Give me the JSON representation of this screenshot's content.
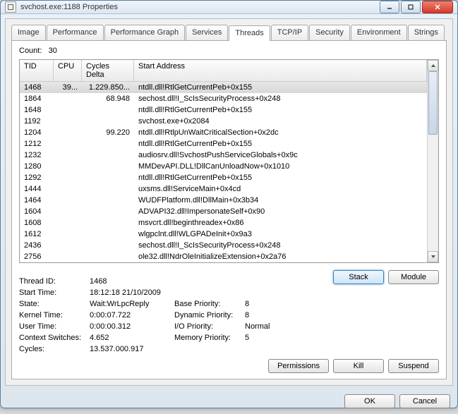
{
  "window": {
    "title": "svchost.exe:1188 Properties"
  },
  "tabs": [
    "Image",
    "Performance",
    "Performance Graph",
    "Services",
    "Threads",
    "TCP/IP",
    "Security",
    "Environment",
    "Strings"
  ],
  "active_tab": 4,
  "count_label": "Count:",
  "count_value": "30",
  "columns": {
    "tid": "TID",
    "cpu": "CPU",
    "cyc": "Cycles Delta",
    "addr": "Start Address"
  },
  "rows": [
    {
      "tid": "1468",
      "cpu": "39...",
      "cyc": "1.229.850...",
      "addr": "ntdll.dll!RtlGetCurrentPeb+0x155",
      "sel": true
    },
    {
      "tid": "1864",
      "cpu": "",
      "cyc": "68.948",
      "addr": "sechost.dll!I_ScIsSecurityProcess+0x248"
    },
    {
      "tid": "1648",
      "cpu": "",
      "cyc": "",
      "addr": "ntdll.dll!RtlGetCurrentPeb+0x155"
    },
    {
      "tid": "1192",
      "cpu": "",
      "cyc": "",
      "addr": "svchost.exe+0x2084"
    },
    {
      "tid": "1204",
      "cpu": "",
      "cyc": "99.220",
      "addr": "ntdll.dll!RtlpUnWaitCriticalSection+0x2dc"
    },
    {
      "tid": "1212",
      "cpu": "",
      "cyc": "",
      "addr": "ntdll.dll!RtlGetCurrentPeb+0x155"
    },
    {
      "tid": "1232",
      "cpu": "",
      "cyc": "",
      "addr": "audiosrv.dll!SvchostPushServiceGlobals+0x9c"
    },
    {
      "tid": "1280",
      "cpu": "",
      "cyc": "",
      "addr": "MMDevAPI.DLL!DllCanUnloadNow+0x1010"
    },
    {
      "tid": "1292",
      "cpu": "",
      "cyc": "",
      "addr": "ntdll.dll!RtlGetCurrentPeb+0x155"
    },
    {
      "tid": "1444",
      "cpu": "",
      "cyc": "",
      "addr": "uxsms.dll!ServiceMain+0x4cd"
    },
    {
      "tid": "1464",
      "cpu": "",
      "cyc": "",
      "addr": "WUDFPlatform.dll!DllMain+0x3b34"
    },
    {
      "tid": "1604",
      "cpu": "",
      "cyc": "",
      "addr": "ADVAPI32.dll!ImpersonateSelf+0x90"
    },
    {
      "tid": "1608",
      "cpu": "",
      "cyc": "",
      "addr": "msvcrt.dll!beginthreadex+0x86"
    },
    {
      "tid": "1612",
      "cpu": "",
      "cyc": "",
      "addr": "wlgpclnt.dll!WLGPADeInit+0x9a3"
    },
    {
      "tid": "2436",
      "cpu": "",
      "cyc": "",
      "addr": "sechost.dll!I_ScIsSecurityProcess+0x248"
    },
    {
      "tid": "2756",
      "cpu": "",
      "cyc": "",
      "addr": "ole32.dll!NdrOleInitializeExtension+0x2a76"
    }
  ],
  "details": {
    "thread_id_label": "Thread ID:",
    "thread_id": "1468",
    "start_time_label": "Start Time:",
    "start_time": "18:12:18   21/10/2009",
    "state_label": "State:",
    "state": "Wait:WrLpcReply",
    "kernel_time_label": "Kernel Time:",
    "kernel_time": "0:00:07.722",
    "user_time_label": "User Time:",
    "user_time": "0:00:00.312",
    "ctx_label": "Context Switches:",
    "ctx": "4.652",
    "cycles_label": "Cycles:",
    "cycles": "13.537.000.917",
    "base_prio_label": "Base Priority:",
    "base_prio": "8",
    "dyn_prio_label": "Dynamic Priority:",
    "dyn_prio": "8",
    "io_prio_label": "I/O Priority:",
    "io_prio": "Normal",
    "mem_prio_label": "Memory Priority:",
    "mem_prio": "5"
  },
  "buttons": {
    "stack": "Stack",
    "module": "Module",
    "permissions": "Permissions",
    "kill": "Kill",
    "suspend": "Suspend",
    "ok": "OK",
    "cancel": "Cancel"
  }
}
